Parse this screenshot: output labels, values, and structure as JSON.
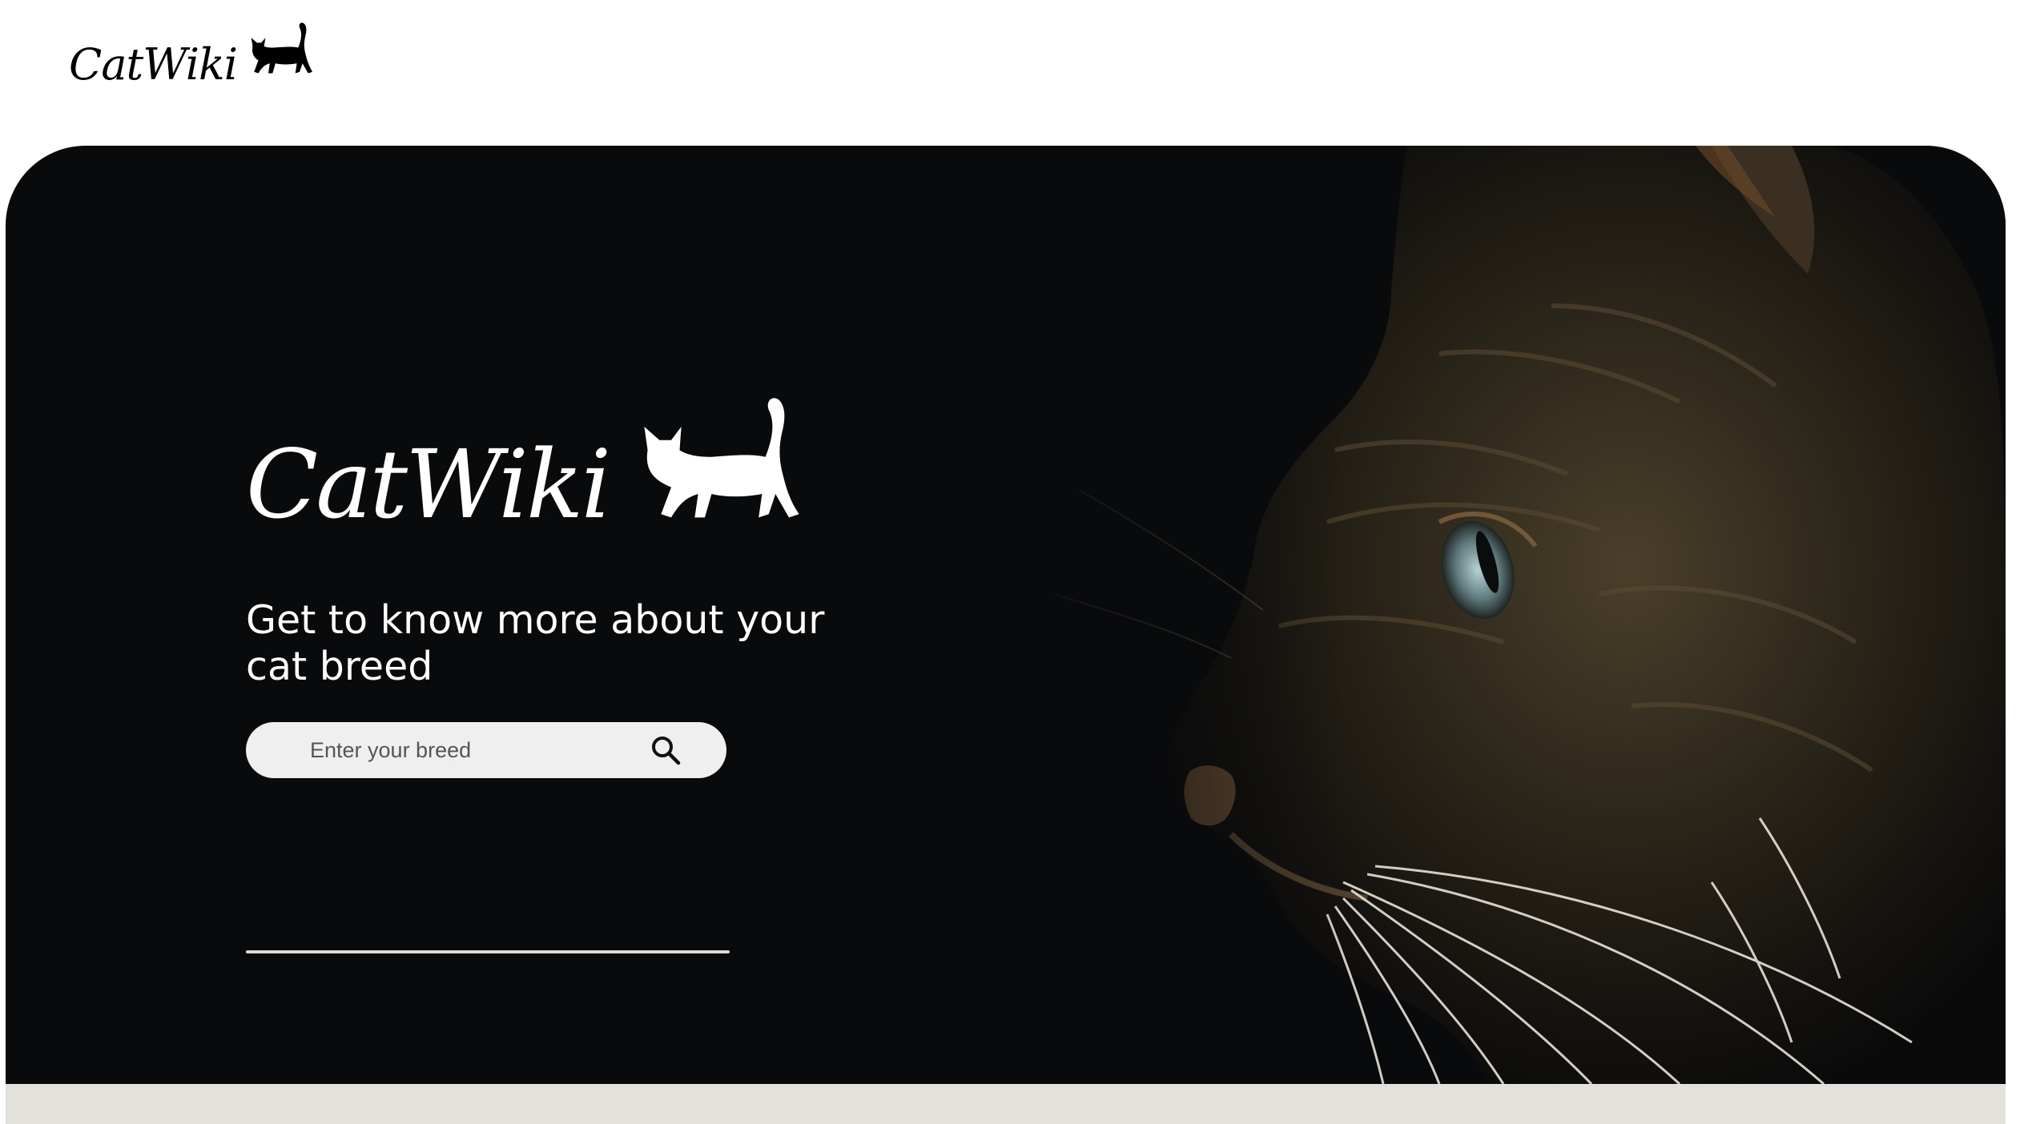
{
  "header": {
    "logo_text": "CatWiki",
    "logo_icon": "cat-silhouette-icon"
  },
  "hero": {
    "logo_text": "CatWiki",
    "logo_icon": "cat-silhouette-icon",
    "tagline": "Get to know more about your cat breed",
    "search": {
      "placeholder": "Enter your breed",
      "value": "",
      "icon": "search-icon"
    },
    "image": "cat-profile-photo"
  },
  "colors": {
    "hero_background": "#090a0c",
    "search_background": "#efefef",
    "lower_band": "#e3e1dc",
    "text_light": "#ffffff"
  }
}
